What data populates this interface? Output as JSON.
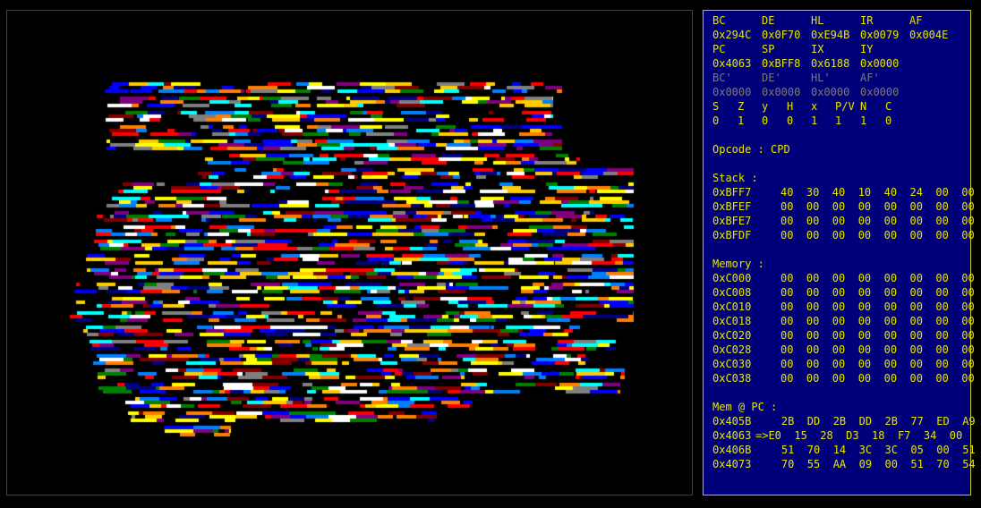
{
  "registers": {
    "row1_labels": [
      "BC",
      "DE",
      "HL",
      "IR",
      "AF"
    ],
    "row1_values": [
      "0x294C",
      "0x0F70",
      "0xE94B",
      "0x0079",
      "0x004E"
    ],
    "row2_labels": [
      "PC",
      "SP",
      "IX",
      "IY"
    ],
    "row2_values": [
      "0x4063",
      "0xBFF8",
      "0x6188",
      "0x0000"
    ],
    "alt_labels": [
      "BC'",
      "DE'",
      "HL'",
      "AF'"
    ],
    "alt_values": [
      "0x0000",
      "0x0000",
      "0x0000",
      "0x0000"
    ],
    "flag_labels": [
      "S",
      "Z",
      "y",
      "H",
      "x",
      "P/V",
      "N",
      "C"
    ],
    "flag_values": [
      "0",
      "1",
      "0",
      "0",
      "1",
      "1",
      "1",
      "0"
    ]
  },
  "opcode": "Opcode : CPD",
  "stack": {
    "title": "Stack :",
    "rows": [
      {
        "addr": "0xBFF7",
        "bytes": "40  30  40  10  40  24  00  00"
      },
      {
        "addr": "0xBFEF",
        "bytes": "00  00  00  00  00  00  00  00"
      },
      {
        "addr": "0xBFE7",
        "bytes": "00  00  00  00  00  00  00  00"
      },
      {
        "addr": "0xBFDF",
        "bytes": "00  00  00  00  00  00  00  00"
      }
    ]
  },
  "memory": {
    "title": "Memory :",
    "rows": [
      {
        "addr": "0xC000",
        "bytes": "00  00  00  00  00  00  00  00"
      },
      {
        "addr": "0xC008",
        "bytes": "00  00  00  00  00  00  00  00"
      },
      {
        "addr": "0xC010",
        "bytes": "00  00  00  00  00  00  00  00"
      },
      {
        "addr": "0xC018",
        "bytes": "00  00  00  00  00  00  00  00"
      },
      {
        "addr": "0xC020",
        "bytes": "00  00  00  00  00  00  00  00"
      },
      {
        "addr": "0xC028",
        "bytes": "00  00  00  00  00  00  00  00"
      },
      {
        "addr": "0xC030",
        "bytes": "00  00  00  00  00  00  00  00"
      },
      {
        "addr": "0xC038",
        "bytes": "00  00  00  00  00  00  00  00"
      }
    ]
  },
  "mem_pc": {
    "title": "Mem @ PC :",
    "rows": [
      {
        "addr": "0x405B",
        "bytes": "    2B  DD  2B  DD  2B  77  ED  A9"
      },
      {
        "addr": "0x4063",
        "bytes": "=>E0  15  28  D3  18  F7  34  00"
      },
      {
        "addr": "0x406B",
        "bytes": "    51  70  14  3C  3C  05  00  51"
      },
      {
        "addr": "0x4073",
        "bytes": "    70  55  AA  09  00  51  70  54"
      }
    ]
  },
  "colors": {
    "panel_bg": "#00007a",
    "panel_text": "#e6e600",
    "panel_border": "#c8c800",
    "screen_border": "#a01818",
    "dim_text": "#7a7a7a",
    "pixel_palette": [
      "#ffffff",
      "#ffff00",
      "#ff8000",
      "#ff0000",
      "#0000ff",
      "#0080ff",
      "#00ffff",
      "#808080",
      "#800000",
      "#800080",
      "#008000",
      "#000080",
      "#ffcc00"
    ]
  }
}
